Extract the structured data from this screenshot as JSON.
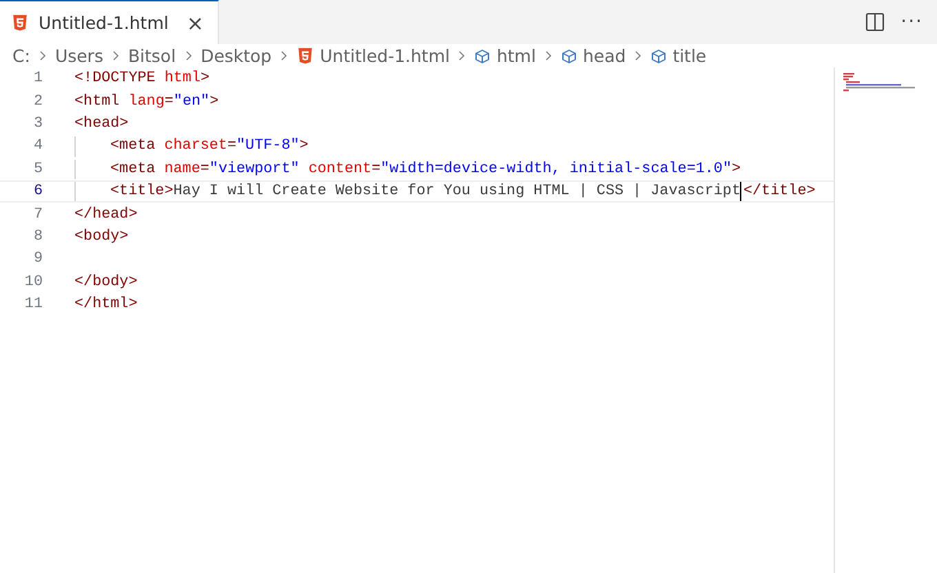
{
  "tab": {
    "label": "Untitled-1.html",
    "selected": true,
    "close": "×"
  },
  "actions": {
    "more": "···"
  },
  "breadcrumbs": [
    {
      "kind": "text",
      "label": "C:"
    },
    {
      "kind": "text",
      "label": "Users"
    },
    {
      "kind": "text",
      "label": "Bitsol"
    },
    {
      "kind": "text",
      "label": "Desktop"
    },
    {
      "kind": "file",
      "label": "Untitled-1.html"
    },
    {
      "kind": "element",
      "label": "html"
    },
    {
      "kind": "element",
      "label": "head"
    },
    {
      "kind": "element",
      "label": "title"
    }
  ],
  "lines": [
    {
      "number": "1",
      "current": false,
      "indented": false,
      "tokens": [
        {
          "kind": "punct",
          "text": "<!DOCTYPE "
        },
        {
          "kind": "attr",
          "text": "html"
        },
        {
          "kind": "punct",
          "text": ">"
        }
      ]
    },
    {
      "number": "2",
      "current": false,
      "indented": false,
      "tokens": [
        {
          "kind": "punct",
          "text": "<html "
        },
        {
          "kind": "attr",
          "text": "lang"
        },
        {
          "kind": "punct",
          "text": "="
        },
        {
          "kind": "string",
          "text": "\"en\""
        },
        {
          "kind": "punct",
          "text": ">"
        }
      ]
    },
    {
      "number": "3",
      "current": false,
      "indented": false,
      "tokens": [
        {
          "kind": "punct",
          "text": "<head>"
        }
      ]
    },
    {
      "number": "4",
      "current": false,
      "indented": true,
      "tokens": [
        {
          "kind": "punct",
          "text": "<meta "
        },
        {
          "kind": "attr",
          "text": "charset"
        },
        {
          "kind": "punct",
          "text": "="
        },
        {
          "kind": "string",
          "text": "\"UTF-8\""
        },
        {
          "kind": "punct",
          "text": ">"
        }
      ]
    },
    {
      "number": "5",
      "current": false,
      "indented": true,
      "tokens": [
        {
          "kind": "punct",
          "text": "<meta "
        },
        {
          "kind": "attr",
          "text": "name"
        },
        {
          "kind": "punct",
          "text": "="
        },
        {
          "kind": "string",
          "text": "\"viewport\""
        },
        {
          "kind": "attr",
          "text": " content"
        },
        {
          "kind": "punct",
          "text": "="
        },
        {
          "kind": "string",
          "text": "\"width=device-width, initial-scale=1.0\""
        },
        {
          "kind": "punct",
          "text": ">"
        }
      ]
    },
    {
      "number": "6",
      "current": true,
      "indented": true,
      "tokens": [
        {
          "kind": "punct",
          "text": "<title>"
        },
        {
          "kind": "text",
          "text": "Hay I will Create Website for You using HTML | CSS | Javascript"
        },
        {
          "kind": "cursor"
        },
        {
          "kind": "punct",
          "text": "</title>"
        }
      ]
    },
    {
      "number": "7",
      "current": false,
      "indented": false,
      "tokens": [
        {
          "kind": "punct",
          "text": "</head>"
        }
      ]
    },
    {
      "number": "8",
      "current": false,
      "indented": false,
      "tokens": [
        {
          "kind": "punct",
          "text": "<body>"
        }
      ]
    },
    {
      "number": "9",
      "current": false
    },
    {
      "number": "10",
      "current": false,
      "indented": false,
      "tokens": [
        {
          "kind": "punct",
          "text": "</body>"
        }
      ]
    },
    {
      "number": "11",
      "current": false,
      "indented": false,
      "tokens": [
        {
          "kind": "punct",
          "text": "</html>"
        }
      ]
    }
  ]
}
